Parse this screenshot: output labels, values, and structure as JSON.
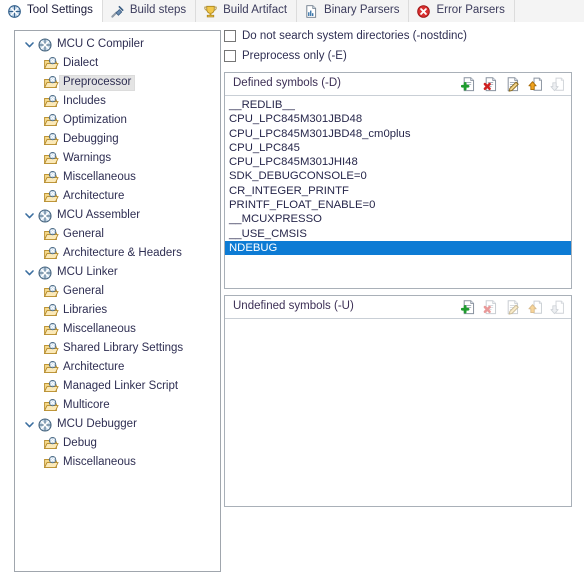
{
  "tabs": [
    {
      "label": "Tool Settings",
      "icon": "tool-settings-icon",
      "active": true
    },
    {
      "label": "Build steps",
      "icon": "build-steps-icon",
      "active": false
    },
    {
      "label": "Build Artifact",
      "icon": "build-artifact-icon",
      "active": false
    },
    {
      "label": "Binary Parsers",
      "icon": "binary-parsers-icon",
      "active": false
    },
    {
      "label": "Error Parsers",
      "icon": "error-parsers-icon",
      "active": false
    }
  ],
  "tree": [
    {
      "label": "MCU C Compiler",
      "level": "parent",
      "expanded": true,
      "selected": false
    },
    {
      "label": "Dialect",
      "level": "child",
      "selected": false
    },
    {
      "label": "Preprocessor",
      "level": "child",
      "selected": true
    },
    {
      "label": "Includes",
      "level": "child",
      "selected": false
    },
    {
      "label": "Optimization",
      "level": "child",
      "selected": false
    },
    {
      "label": "Debugging",
      "level": "child",
      "selected": false
    },
    {
      "label": "Warnings",
      "level": "child",
      "selected": false
    },
    {
      "label": "Miscellaneous",
      "level": "child",
      "selected": false
    },
    {
      "label": "Architecture",
      "level": "child",
      "selected": false
    },
    {
      "label": "MCU Assembler",
      "level": "parent",
      "expanded": true,
      "selected": false
    },
    {
      "label": "General",
      "level": "child",
      "selected": false
    },
    {
      "label": "Architecture & Headers",
      "level": "child",
      "selected": false
    },
    {
      "label": "MCU Linker",
      "level": "parent",
      "expanded": true,
      "selected": false
    },
    {
      "label": "General",
      "level": "child",
      "selected": false
    },
    {
      "label": "Libraries",
      "level": "child",
      "selected": false
    },
    {
      "label": "Miscellaneous",
      "level": "child",
      "selected": false
    },
    {
      "label": "Shared Library Settings",
      "level": "child",
      "selected": false
    },
    {
      "label": "Architecture",
      "level": "child",
      "selected": false
    },
    {
      "label": "Managed Linker Script",
      "level": "child",
      "selected": false
    },
    {
      "label": "Multicore",
      "level": "child",
      "selected": false
    },
    {
      "label": "MCU Debugger",
      "level": "parent",
      "expanded": true,
      "selected": false
    },
    {
      "label": "Debug",
      "level": "child",
      "selected": false
    },
    {
      "label": "Miscellaneous",
      "level": "child",
      "selected": false
    }
  ],
  "options": [
    {
      "label": "Do not search system directories (-nostdinc)",
      "checked": false
    },
    {
      "label": "Preprocess only (-E)",
      "checked": false
    }
  ],
  "defined_symbols": {
    "title": "Defined symbols (-D)",
    "tools": [
      {
        "name": "add-icon",
        "enabled": true
      },
      {
        "name": "delete-icon",
        "enabled": true
      },
      {
        "name": "edit-icon",
        "enabled": true
      },
      {
        "name": "move-up-icon",
        "enabled": true
      },
      {
        "name": "move-down-icon",
        "enabled": false
      }
    ],
    "items": [
      {
        "value": "__REDLIB__",
        "selected": false
      },
      {
        "value": "CPU_LPC845M301JBD48",
        "selected": false
      },
      {
        "value": "CPU_LPC845M301JBD48_cm0plus",
        "selected": false
      },
      {
        "value": "CPU_LPC845",
        "selected": false
      },
      {
        "value": "CPU_LPC845M301JHI48",
        "selected": false
      },
      {
        "value": "SDK_DEBUGCONSOLE=0",
        "selected": false
      },
      {
        "value": "CR_INTEGER_PRINTF",
        "selected": false
      },
      {
        "value": "PRINTF_FLOAT_ENABLE=0",
        "selected": false
      },
      {
        "value": "__MCUXPRESSO",
        "selected": false
      },
      {
        "value": "__USE_CMSIS",
        "selected": false
      },
      {
        "value": "NDEBUG",
        "selected": true
      }
    ]
  },
  "undefined_symbols": {
    "title": "Undefined symbols (-U)",
    "tools": [
      {
        "name": "add-icon",
        "enabled": true
      },
      {
        "name": "delete-icon",
        "enabled": false
      },
      {
        "name": "edit-icon",
        "enabled": false
      },
      {
        "name": "move-up-icon",
        "enabled": false
      },
      {
        "name": "move-down-icon",
        "enabled": false
      }
    ],
    "items": []
  },
  "colors": {
    "selection_blue": "#0d7bd4",
    "tree_selection_gray": "#e4e4e4",
    "text": "#2e2e52",
    "panel_border": "#a0a6ad"
  }
}
